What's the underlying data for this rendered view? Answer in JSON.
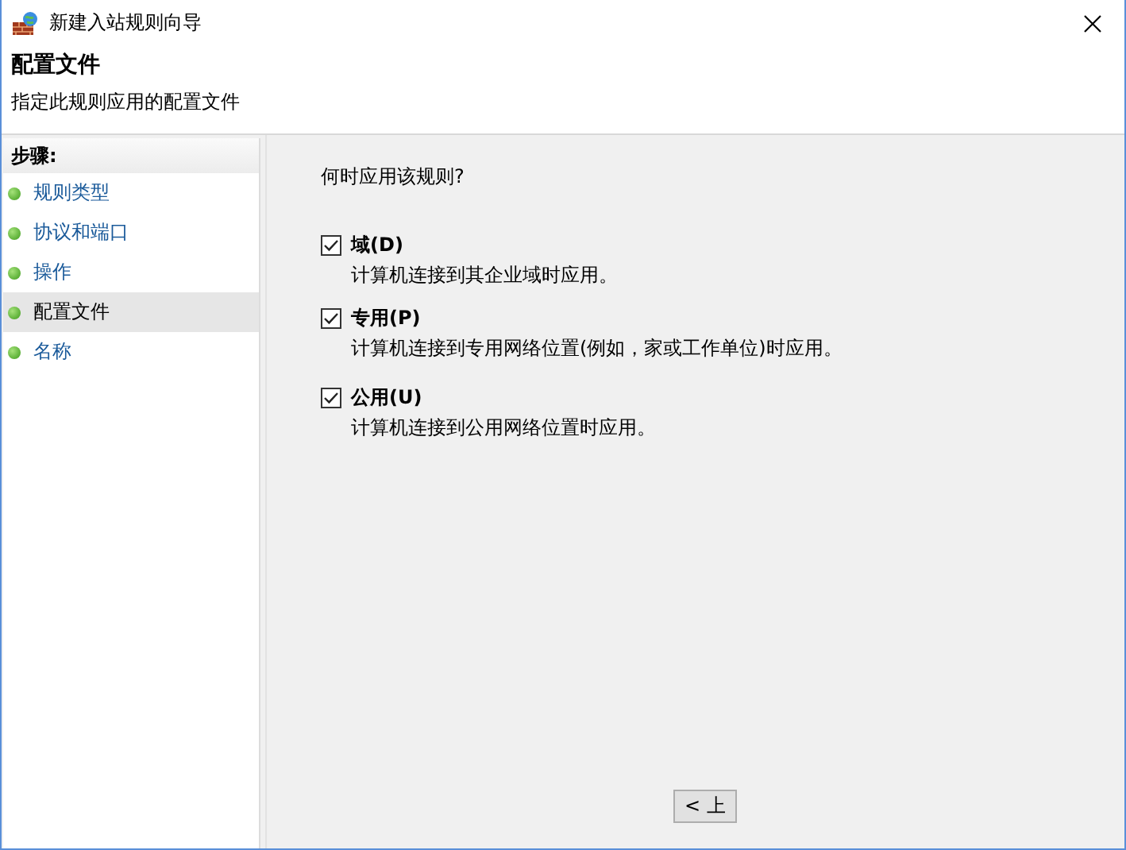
{
  "window": {
    "title": "新建入站规则向导"
  },
  "header": {
    "title": "配置文件",
    "subtitle": "指定此规则应用的配置文件"
  },
  "steps": {
    "heading": "步骤:",
    "items": [
      {
        "label": "规则类型",
        "selected": false
      },
      {
        "label": "协议和端口",
        "selected": false
      },
      {
        "label": "操作",
        "selected": false
      },
      {
        "label": "配置文件",
        "selected": true
      },
      {
        "label": "名称",
        "selected": false
      }
    ]
  },
  "content": {
    "question": "何时应用该规则?",
    "options": [
      {
        "label": "域(D)",
        "description": "计算机连接到其企业域时应用。",
        "checked": true
      },
      {
        "label": "专用(P)",
        "description": "计算机连接到专用网络位置(例如，家或工作单位)时应用。",
        "checked": true
      },
      {
        "label": "公用(U)",
        "description": "计算机连接到公用网络位置时应用。",
        "checked": true
      }
    ]
  },
  "buttons": [
    "< 上"
  ]
}
